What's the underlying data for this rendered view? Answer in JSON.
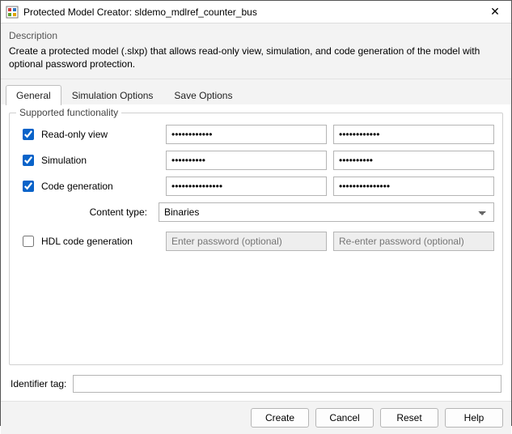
{
  "window": {
    "title": "Protected Model Creator: sldemo_mdlref_counter_bus"
  },
  "description": {
    "heading": "Description",
    "body": "Create a protected model (.slxp) that allows read-only view, simulation, and code generation of the model with optional password protection."
  },
  "tabs": {
    "general": "General",
    "simulation": "Simulation Options",
    "save": "Save Options"
  },
  "group": {
    "legend": "Supported functionality",
    "rows": {
      "readonly": {
        "label": "Read-only view",
        "pw1": "••••••••••••",
        "pw2": "••••••••••••"
      },
      "sim": {
        "label": "Simulation",
        "pw1": "••••••••••",
        "pw2": "••••••••••"
      },
      "codegen": {
        "label": "Code generation",
        "pw1": "•••••••••••••••",
        "pw2": "•••••••••••••••"
      },
      "hdl": {
        "label": "HDL code generation",
        "ph1": "Enter password (optional)",
        "ph2": "Re-enter password (optional)"
      }
    },
    "content": {
      "label": "Content type:",
      "value": "Binaries"
    }
  },
  "identifier": {
    "label": "Identifier tag:",
    "value": ""
  },
  "buttons": {
    "create": "Create",
    "cancel": "Cancel",
    "reset": "Reset",
    "help": "Help"
  }
}
